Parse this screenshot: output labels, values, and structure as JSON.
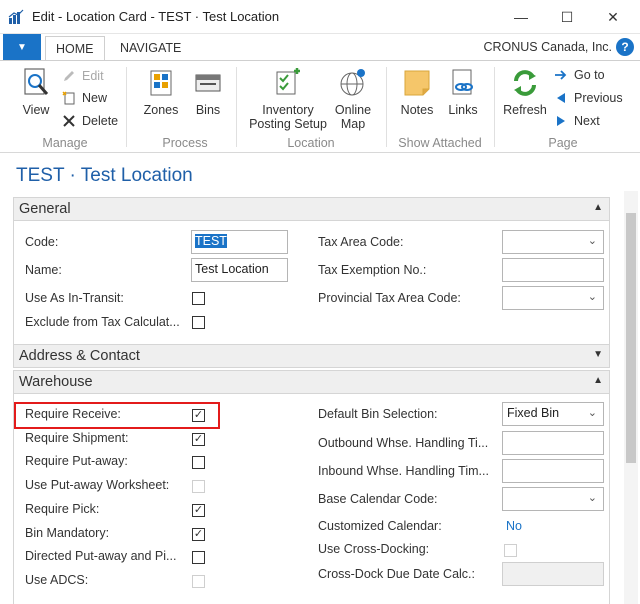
{
  "window": {
    "title": "Edit - Location Card - TEST · Test Location",
    "minimize": "—",
    "maximize": "☐",
    "close": "✕"
  },
  "ribbon_tabs": {
    "home": "HOME",
    "navigate": "NAVIGATE",
    "company": "CRONUS Canada, Inc.",
    "help": "?"
  },
  "ribbon": {
    "manage": {
      "label": "Manage",
      "view": "View",
      "edit": "Edit",
      "new": "New",
      "delete": "Delete"
    },
    "process": {
      "label": "Process",
      "zones": "Zones",
      "bins": "Bins"
    },
    "location": {
      "label": "Location",
      "inventory_posting_setup_1": "Inventory",
      "inventory_posting_setup_2": "Posting Setup",
      "online_map_1": "Online",
      "online_map_2": "Map"
    },
    "show_attached": {
      "label": "Show Attached",
      "notes": "Notes",
      "links": "Links"
    },
    "page": {
      "label": "Page",
      "refresh": "Refresh",
      "go_to": "Go to",
      "previous": "Previous",
      "next": "Next"
    }
  },
  "card": {
    "title": "TEST · Test Location"
  },
  "general": {
    "header": "General",
    "code_label": "Code:",
    "code_value": "TEST",
    "name_label": "Name:",
    "name_value": "Test Location",
    "in_transit_label": "Use As In-Transit:",
    "in_transit_checked": false,
    "exclude_tax_label": "Exclude from Tax Calculat...",
    "exclude_tax_checked": false,
    "tax_area_label": "Tax Area Code:",
    "tax_area_value": "",
    "tax_exemption_label": "Tax Exemption No.:",
    "tax_exemption_value": "",
    "provincial_tax_label": "Provincial Tax Area Code:",
    "provincial_tax_value": ""
  },
  "address": {
    "header": "Address & Contact"
  },
  "warehouse": {
    "header": "Warehouse",
    "left": [
      {
        "label": "Require Receive:",
        "checked": true,
        "disabled": false
      },
      {
        "label": "Require Shipment:",
        "checked": true,
        "disabled": false
      },
      {
        "label": "Require Put-away:",
        "checked": false,
        "disabled": false
      },
      {
        "label": "Use Put-away Worksheet:",
        "checked": false,
        "disabled": true
      },
      {
        "label": "Require Pick:",
        "checked": true,
        "disabled": false
      },
      {
        "label": "Bin Mandatory:",
        "checked": true,
        "disabled": false
      },
      {
        "label": "Directed Put-away and Pi...",
        "checked": false,
        "disabled": false
      },
      {
        "label": "Use ADCS:",
        "checked": false,
        "disabled": true
      }
    ],
    "default_bin_label": "Default Bin Selection:",
    "default_bin_value": "Fixed Bin",
    "outbound_label": "Outbound Whse. Handling Ti...",
    "outbound_value": "",
    "inbound_label": "Inbound Whse. Handling Tim...",
    "inbound_value": "",
    "base_calendar_label": "Base Calendar Code:",
    "base_calendar_value": "",
    "customized_calendar_label": "Customized Calendar:",
    "customized_calendar_value": "No",
    "cross_docking_label": "Use Cross-Docking:",
    "cross_docking_checked": false,
    "cross_dock_due_label": "Cross-Dock Due Date Calc.:",
    "cross_dock_due_value": ""
  },
  "colors": {
    "accent": "#1a73c7",
    "title_blue": "#1f5fa8",
    "highlight_red": "#e31b1b"
  }
}
